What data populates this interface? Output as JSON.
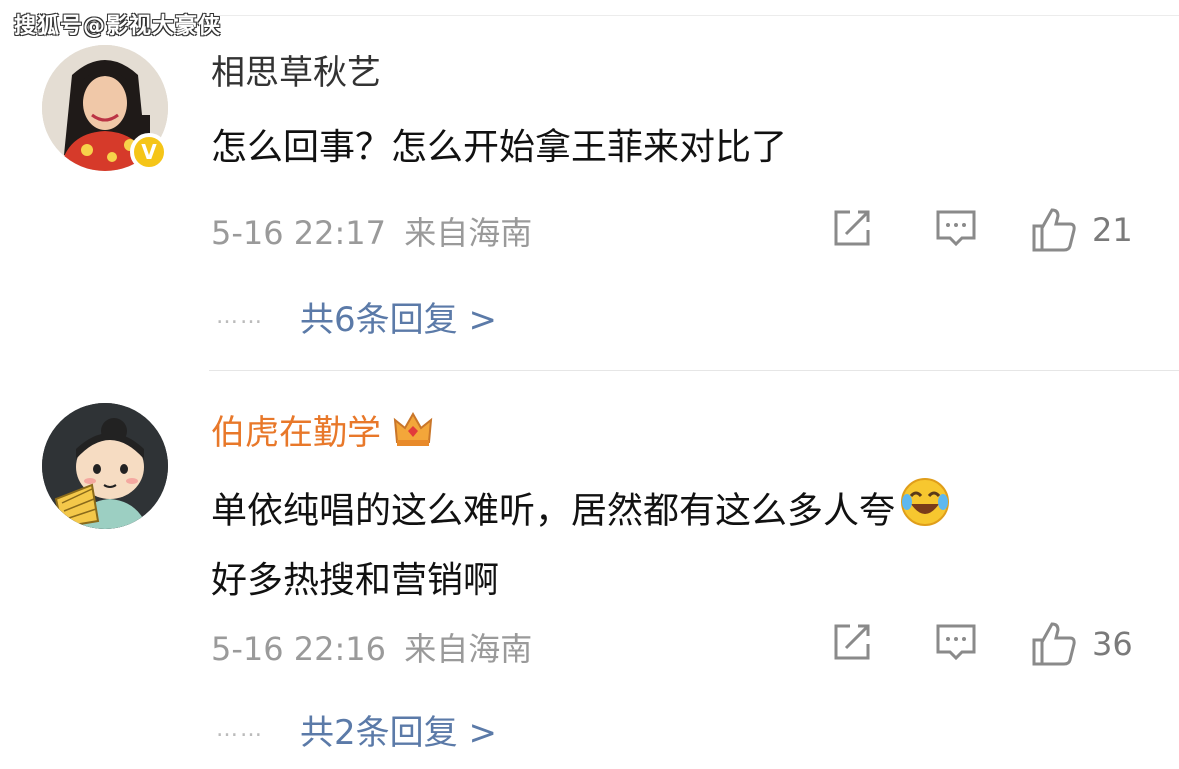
{
  "watermark": "搜狐号@影视大豪侠",
  "comments": [
    {
      "username": "相思草秋艺",
      "verified_badge": "V",
      "lines": [
        "怎么回事？怎么开始拿王菲来对比了"
      ],
      "time": "5-16 22:17",
      "location": "来自海南",
      "likes": "21",
      "replies_label": "共6条回复 >",
      "avatar_icon": "girl-portrait-avatar"
    },
    {
      "username": "伯虎在勤学",
      "badge_icon": "crown-icon",
      "lines": [
        "单依纯唱的这么难听，居然都有这么多人夸",
        "好多热搜和营销啊"
      ],
      "emoji_icon": "laughing-tears-emoji",
      "time": "5-16 22:16",
      "location": "来自海南",
      "likes": "36",
      "replies_label": "共2条回复 >",
      "avatar_icon": "cartoon-scholar-avatar"
    }
  ],
  "more_dots": "……",
  "colors": {
    "vip_name": "#e8782a",
    "reply_link": "#5b7aa8",
    "meta_gray": "#9a9a9a",
    "badge_yellow": "#f5c518"
  }
}
